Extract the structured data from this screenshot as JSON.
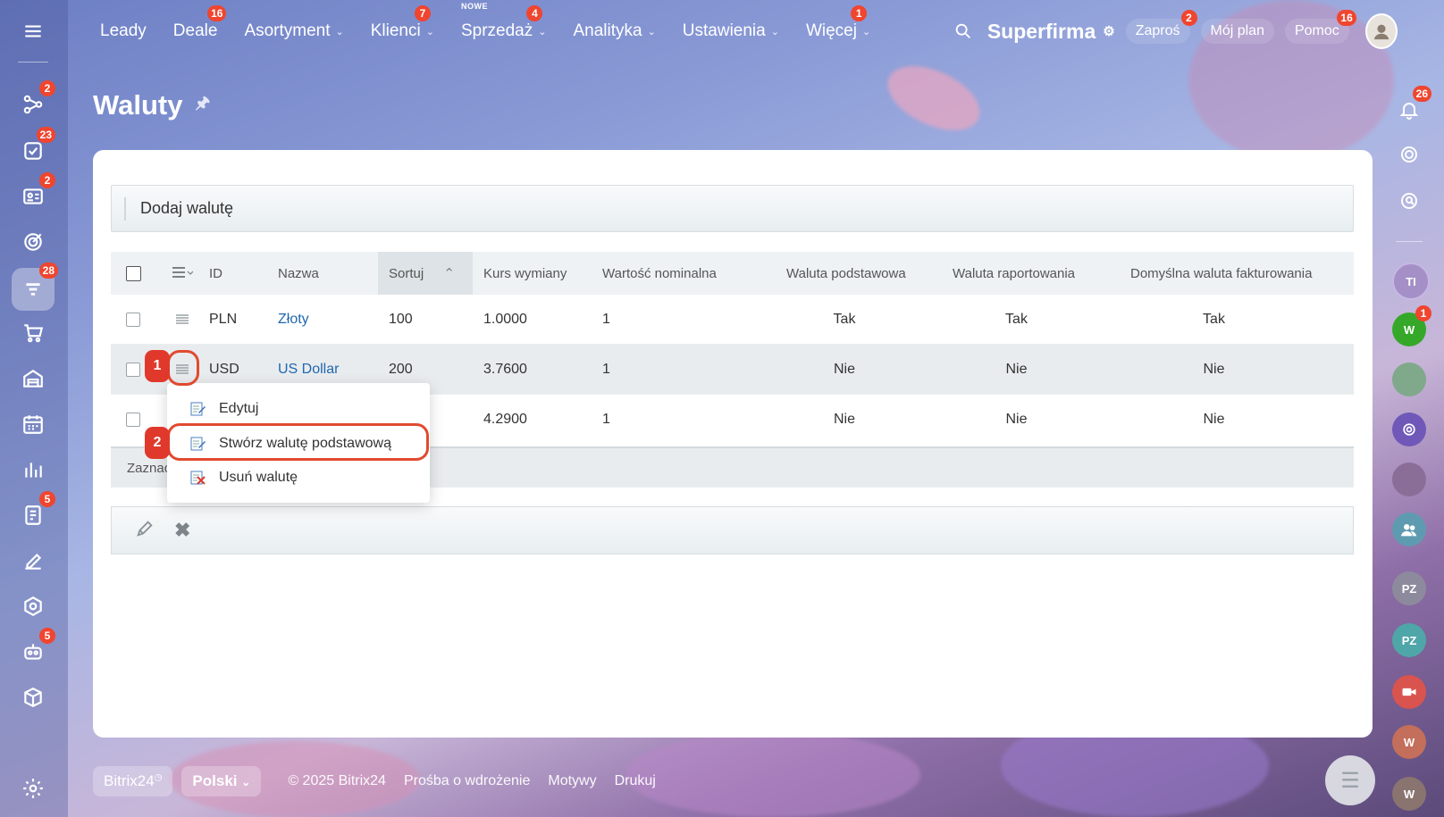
{
  "topnav": {
    "items": [
      {
        "label": "Leady",
        "badge": "",
        "chevron": false,
        "new": ""
      },
      {
        "label": "Deale",
        "badge": "16",
        "chevron": false,
        "new": ""
      },
      {
        "label": "Asortyment",
        "badge": "",
        "chevron": true,
        "new": ""
      },
      {
        "label": "Klienci",
        "badge": "7",
        "chevron": true,
        "new": ""
      },
      {
        "label": "Sprzedaż",
        "badge": "4",
        "chevron": true,
        "new": "NOWE"
      },
      {
        "label": "Analityka",
        "badge": "",
        "chevron": true,
        "new": ""
      },
      {
        "label": "Ustawienia",
        "badge": "",
        "chevron": true,
        "new": ""
      },
      {
        "label": "Więcej",
        "badge": "1",
        "chevron": true,
        "new": ""
      }
    ],
    "brand": "Superfirma",
    "invite": {
      "label": "Zaproś",
      "badge": "2"
    },
    "plan": {
      "label": "Mój plan"
    },
    "help": {
      "label": "Pomoc",
      "badge": "16"
    }
  },
  "left_sidebar": {
    "badges": {
      "pipeline": "2",
      "tasks": "23",
      "contacts": "2",
      "crm": "28",
      "docs": "5",
      "robot": "5"
    }
  },
  "right_sidebar": {
    "notifications_badge": "26",
    "avatars": [
      {
        "initials": "TI",
        "badge": ""
      },
      {
        "initials": "W",
        "badge": "1"
      },
      {
        "initials": "PZ",
        "badge": ""
      },
      {
        "initials": "PZ",
        "badge": ""
      },
      {
        "initials": "W",
        "badge": ""
      },
      {
        "initials": "W",
        "badge": ""
      }
    ]
  },
  "page": {
    "title": "Waluty"
  },
  "add_bar": {
    "label": "Dodaj walutę"
  },
  "grid": {
    "columns": {
      "id": "ID",
      "name": "Nazwa",
      "sort": "Sortuj",
      "rate": "Kurs wymiany",
      "nominal": "Wartość nominalna",
      "base": "Waluta podstawowa",
      "report": "Waluta raportowania",
      "invoice": "Domyślna waluta fakturowania"
    },
    "rows": [
      {
        "id": "PLN",
        "name": "Złoty",
        "sort": "100",
        "rate": "1.0000",
        "nominal": "1",
        "base": "Tak",
        "report": "Tak",
        "invoice": "Tak"
      },
      {
        "id": "USD",
        "name": "US Dollar",
        "sort": "200",
        "rate": "3.7600",
        "nominal": "1",
        "base": "Nie",
        "report": "Nie",
        "invoice": "Nie"
      },
      {
        "id": "",
        "name": "",
        "sort": "",
        "rate": "4.2900",
        "nominal": "1",
        "base": "Nie",
        "report": "Nie",
        "invoice": "Nie"
      }
    ],
    "footer_text": "Zaznac"
  },
  "context_menu": {
    "items": [
      {
        "label": "Edytuj"
      },
      {
        "label": "Stwórz walutę podstawową"
      },
      {
        "label": "Usuń walutę"
      }
    ]
  },
  "steps": {
    "one": "1",
    "two": "2"
  },
  "footer": {
    "bitrix": "Bitrix24",
    "language": "Polski",
    "copyright": "© 2025 Bitrix24",
    "links": [
      "Prośba o wdrożenie",
      "Motywy",
      "Drukuj"
    ]
  }
}
